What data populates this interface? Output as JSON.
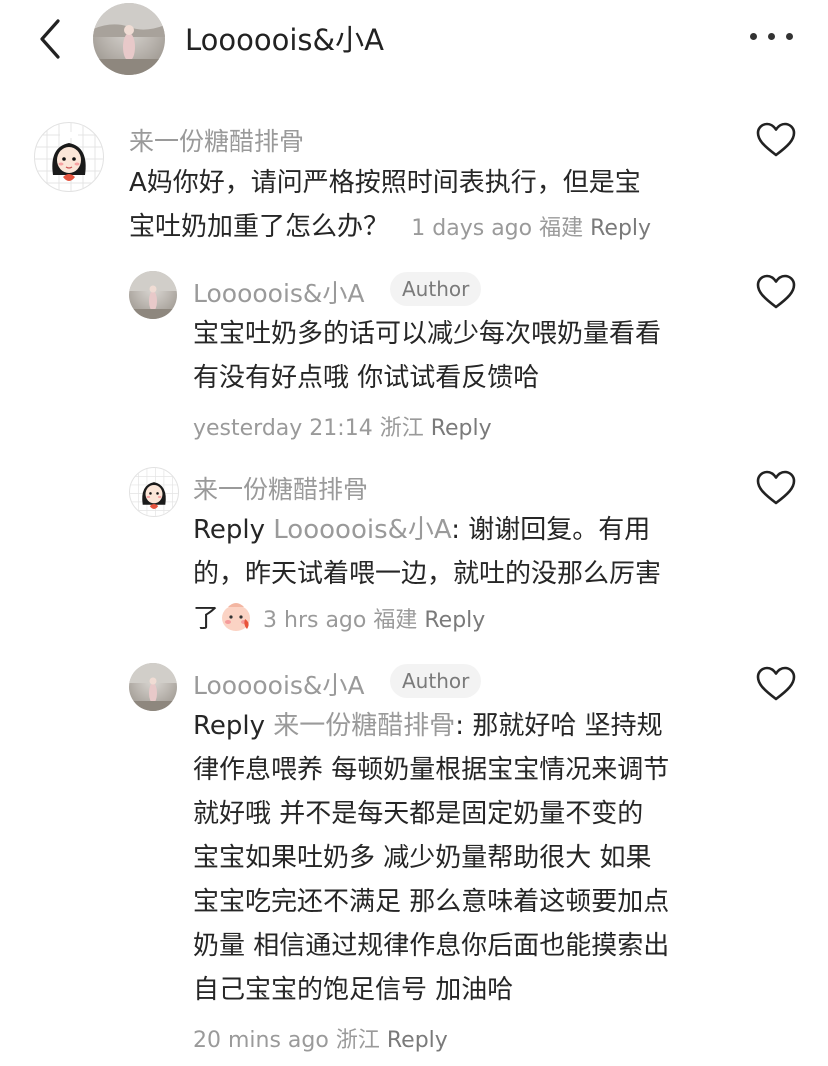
{
  "header": {
    "name": "Looooois&小A"
  },
  "comments": [
    {
      "user": "来一份糖醋排骨",
      "text_lines": [
        "A妈你好，请问严格按照时间表执行，但是宝",
        "宝吐奶加重了怎么办？"
      ],
      "meta": {
        "time": "1 days ago",
        "location": "福建",
        "reply": "Reply"
      }
    },
    {
      "user": "Looooois&小A",
      "badge": "Author",
      "text_lines": [
        "宝宝吐奶多的话可以减少每次喂奶量看看",
        "有没有好点哦 你试试看反馈哈"
      ],
      "meta": {
        "time": "yesterday 21:14",
        "location": "浙江",
        "reply": "Reply"
      }
    },
    {
      "user": "来一份糖醋排骨",
      "reply_prefix": "Reply",
      "reply_to": "Looooois&小A",
      "text_lines": [
        "谢谢回复。有用",
        "的，昨天试着喂一边，就吐的没那么厉害",
        "了"
      ],
      "meta": {
        "time": "3 hrs ago",
        "location": "福建",
        "reply": "Reply"
      }
    },
    {
      "user": "Looooois&小A",
      "badge": "Author",
      "reply_prefix": "Reply",
      "reply_to": "来一份糖醋排骨",
      "text_lines": [
        "那就好哈 坚持规",
        "律作息喂养 每顿奶量根据宝宝情况来调节",
        "就好哦 并不是每天都是固定奶量不变的",
        "宝宝如果吐奶多 减少奶量帮助很大 如果",
        "宝宝吃完还不满足 那么意味着这顿要加点",
        "奶量 相信通过规律作息你后面也能摸索出",
        "自己宝宝的饱足信号 加油哈"
      ],
      "meta": {
        "time": "20 mins ago",
        "location": "浙江",
        "reply": "Reply"
      }
    }
  ],
  "icons": {
    "back": "chevron-left-icon",
    "more": "more-dots-icon",
    "like": "heart-outline-icon",
    "emoji": "baby-face-emoji-icon"
  },
  "colors": {
    "text": "#262626",
    "muted": "#9a9a9a",
    "badge_bg": "#f3f3f3"
  }
}
